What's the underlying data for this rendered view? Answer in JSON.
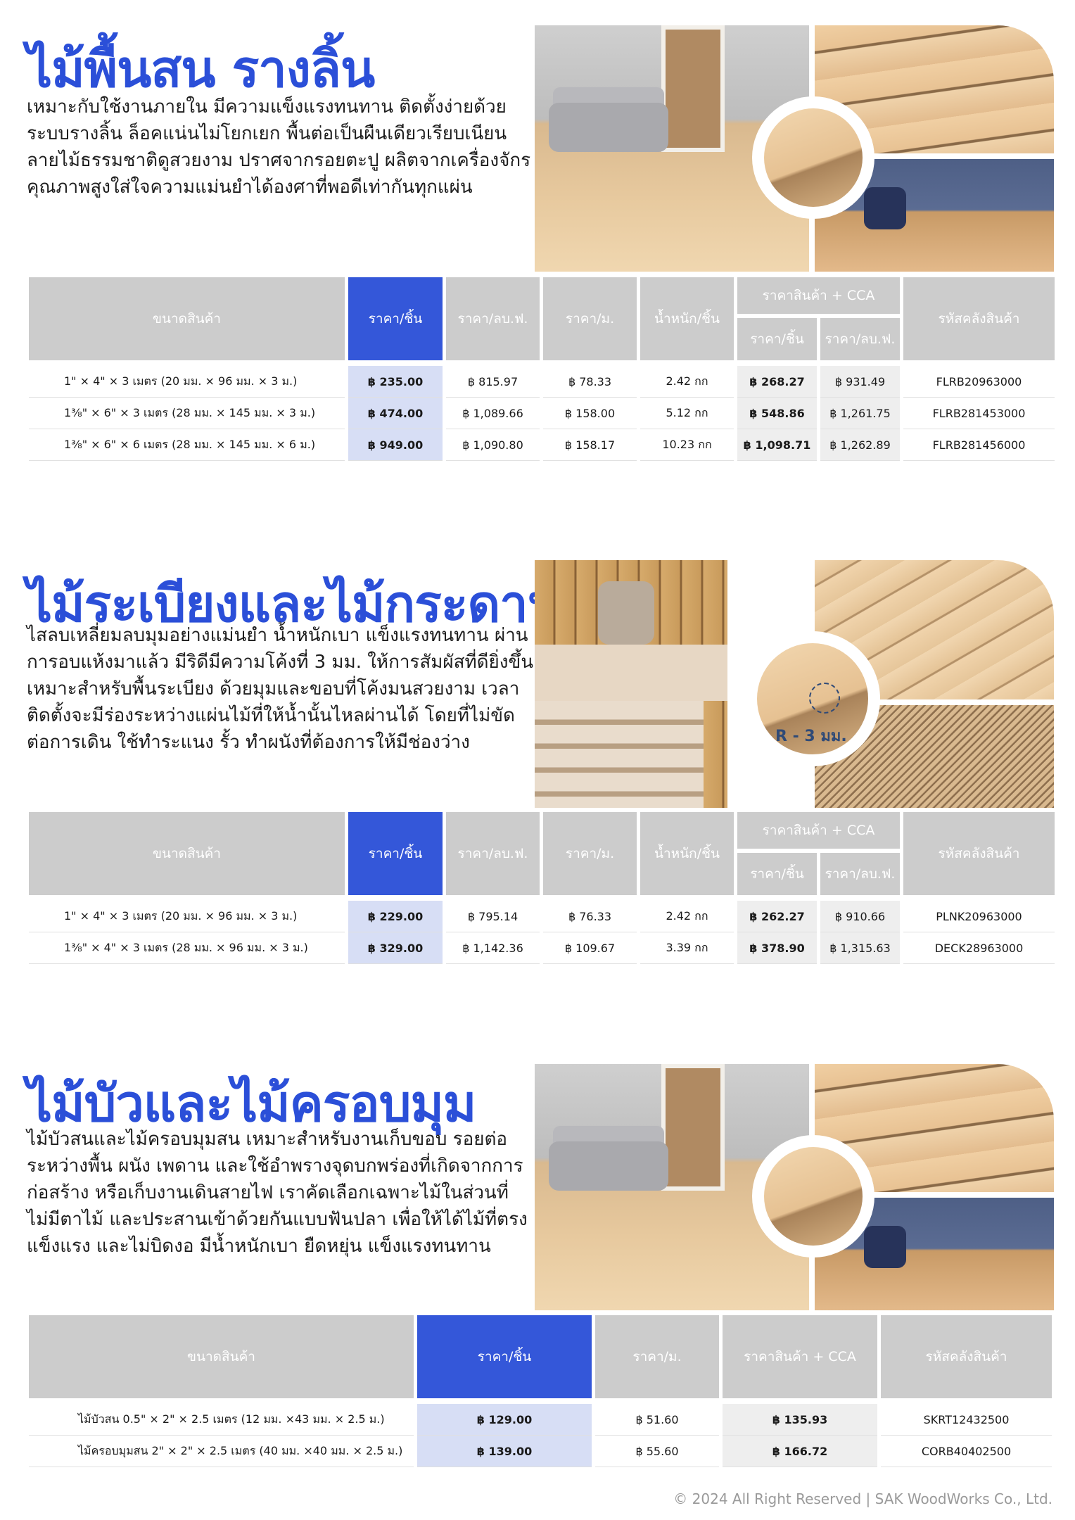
{
  "sections": [
    {
      "title": "ไม้พื้นสน รางลิ้น",
      "desc": [
        "เหมาะกับใช้งานภายใน มีความแข็งแรงทนทาน ติดตั้งง่ายด้วย",
        "ระบบรางลิ้น ล็อคแน่นไม่โยกเยก พื้นต่อเป็นผืนเดียวเรียบเนียน",
        "ลายไม้ธรรมชาติดูสวยงาม ปราศจากรอยตะปู ผลิตจากเครื่องจักร",
        "คุณภาพสูงใส่ใจความแม่นยำได้องศาที่พอดีเท่ากันทุกแผ่น"
      ],
      "headers": {
        "size": "ขนาดสินค้า",
        "price_piece": "ราคา/ชิ้น",
        "price_sqft": "ราคา/ลบ.ฟ.",
        "price_m": "ราคา/ม.",
        "weight": "น้ำหนัก/ชิ้น",
        "cca": "ราคาสินค้า + CCA",
        "cca_piece": "ราคา/ชิ้น",
        "cca_sqft": "ราคา/ลบ.ฟ.",
        "sku": "รหัสคลังสินค้า"
      },
      "rows": [
        {
          "size": "1\" × 4\" × 3 เมตร (20 มม. × 96 มม. × 3 ม.)",
          "price_piece": "฿ 235.00",
          "price_sqft": "฿ 815.97",
          "price_m": "฿ 78.33",
          "weight": "2.42 กก",
          "cca_piece": "฿ 268.27",
          "cca_sqft": "฿ 931.49",
          "sku": "FLRB20963000"
        },
        {
          "size": "1⅜\" × 6\" × 3 เมตร (28 มม. × 145 มม. × 3 ม.)",
          "price_piece": "฿ 474.00",
          "price_sqft": "฿ 1,089.66",
          "price_m": "฿ 158.00",
          "weight": "5.12 กก",
          "cca_piece": "฿ 548.86",
          "cca_sqft": "฿ 1,261.75",
          "sku": "FLRB281453000"
        },
        {
          "size": "1⅜\" × 6\" × 6 เมตร (28 มม. × 145 มม. × 6 ม.)",
          "price_piece": "฿ 949.00",
          "price_sqft": "฿ 1,090.80",
          "price_m": "฿ 158.17",
          "weight": "10.23 กก",
          "cca_piece": "฿ 1,098.71",
          "cca_sqft": "฿ 1,262.89",
          "sku": "FLRB281456000"
        }
      ]
    },
    {
      "title": "ไม้ระเบียงและไม้กระดาน",
      "desc": [
        "ไสลบเหลี่ยมลบมุมอย่างแม่นยำ น้ำหนักเบา แข็งแรงทนทาน ผ่าน",
        "การอบแห้งมาแล้ว มีริดีมีความโค้งที่ 3 มม. ให้การสัมผัสที่ดียิ่งขึ้น",
        "เหมาะสำหรับพื้นระเบียง ด้วยมุมและขอบที่โค้งมนสวยงาม เวลา",
        "ติดตั้งจะมีร่องระหว่างแผ่นไม้ที่ให้น้ำนั้นไหลผ่านได้ โดยที่ไม่ขัด",
        "ต่อการเดิน ใช้ทำระแนง รั้ว ทำผนังที่ต้องการให้มีช่องว่าง"
      ],
      "radius_label": "R - 3 มม.",
      "headers": {
        "size": "ขนาดสินค้า",
        "price_piece": "ราคา/ชิ้น",
        "price_sqft": "ราคา/ลบ.ฟ.",
        "price_m": "ราคา/ม.",
        "weight": "น้ำหนัก/ชิ้น",
        "cca": "ราคาสินค้า + CCA",
        "cca_piece": "ราคา/ชิ้น",
        "cca_sqft": "ราคา/ลบ.ฟ.",
        "sku": "รหัสคลังสินค้า"
      },
      "rows": [
        {
          "size": "1\" × 4\" × 3 เมตร (20 มม. × 96 มม. × 3 ม.)",
          "price_piece": "฿ 229.00",
          "price_sqft": "฿ 795.14",
          "price_m": "฿ 76.33",
          "weight": "2.42 กก",
          "cca_piece": "฿ 262.27",
          "cca_sqft": "฿ 910.66",
          "sku": "PLNK20963000"
        },
        {
          "size": "1⅜\" × 4\" × 3 เมตร (28 มม. × 96 มม. × 3 ม.)",
          "price_piece": "฿ 329.00",
          "price_sqft": "฿ 1,142.36",
          "price_m": "฿ 109.67",
          "weight": "3.39 กก",
          "cca_piece": "฿ 378.90",
          "cca_sqft": "฿ 1,315.63",
          "sku": "DECK28963000"
        }
      ]
    },
    {
      "title": "ไม้บัวและไม้ครอบมุม",
      "desc": [
        "ไม้บัวสนและไม้ครอบมุมสน เหมาะสำหรับงานเก็บขอบ รอยต่อ",
        "ระหว่างพื้น ผนัง เพดาน และใช้อำพรางจุดบกพร่องที่เกิดจากการ",
        "ก่อสร้าง หรือเก็บงานเดินสายไฟ เราคัดเลือกเฉพาะไม้ในส่วนที่",
        "ไม่มีตาไม้ และประสานเข้าด้วยกันแบบฟันปลา เพื่อให้ได้ไม้ที่ตรง",
        "แข็งแรง และไม่บิดงอ มีน้ำหนักเบา ยืดหยุ่น แข็งแรงทนทาน"
      ],
      "headers": {
        "size": "ขนาดสินค้า",
        "price_piece": "ราคา/ชิ้น",
        "price_m": "ราคา/ม.",
        "cca": "ราคาสินค้า + CCA",
        "sku": "รหัสคลังสินค้า"
      },
      "rows": [
        {
          "size": "ไม้บัวสน 0.5\" × 2\" × 2.5 เมตร (12 มม. ×43 มม. × 2.5 ม.)",
          "price_piece": "฿ 129.00",
          "price_m": "฿ 51.60",
          "cca": "฿ 135.93",
          "sku": "SKRT12432500"
        },
        {
          "size": "ไม้ครอบมุมสน  2\" × 2\" × 2.5 เมตร (40 มม. ×40 มม. × 2.5 ม.)",
          "price_piece": "฿ 139.00",
          "price_m": "฿ 55.60",
          "cca": "฿ 166.72",
          "sku": "CORB40402500"
        }
      ]
    }
  ],
  "footer": "© 2024 All Right Reserved | SAK WoodWorks Co., Ltd."
}
